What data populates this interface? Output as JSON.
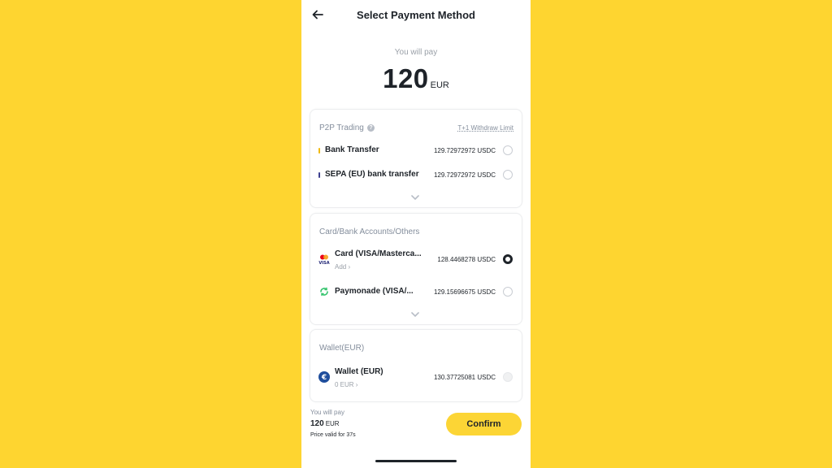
{
  "header": {
    "title": "Select Payment Method",
    "back_icon": "arrow-left-icon"
  },
  "summary": {
    "label": "You will pay",
    "amount": "120",
    "currency": "EUR"
  },
  "p2p": {
    "title": "P2P Trading",
    "help_icon": "question-circle-icon",
    "limit_link": "T+1 Withdraw Limit",
    "items": [
      {
        "label": "Bank Transfer",
        "amount": "129.72972972 USDC",
        "marker_color": "#F0B90B",
        "selected": false
      },
      {
        "label": "SEPA (EU) bank transfer",
        "amount": "129.72972972 USDC",
        "marker_color": "#3C3F8F",
        "selected": false
      }
    ]
  },
  "cards": {
    "title": "Card/Bank Accounts/Others",
    "items": [
      {
        "label": "Card (VISA/Mastercа...",
        "sub": "Add",
        "amount": "128.4468278 USDC",
        "icon": "visa-mastercard-icon",
        "selected": true
      },
      {
        "label": "Paymonade (VISA/...",
        "amount": "129.15696675 USDC",
        "icon": "paymonade-icon",
        "selected": false
      }
    ]
  },
  "wallet": {
    "title": "Wallet(EUR)",
    "items": [
      {
        "label": "Wallet (EUR)",
        "sub": "0 EUR",
        "amount": "130.37725081 USDC",
        "icon": "euro-coin-icon",
        "selected": false,
        "disabled": true
      }
    ]
  },
  "footer": {
    "label": "You will pay",
    "amount": "120",
    "currency": "EUR",
    "validity": "Price valid for 37s",
    "confirm_label": "Confirm"
  },
  "colors": {
    "background": "#FED530",
    "accent": "#FCD535",
    "text": "#1E2329",
    "muted": "#848E9C"
  }
}
